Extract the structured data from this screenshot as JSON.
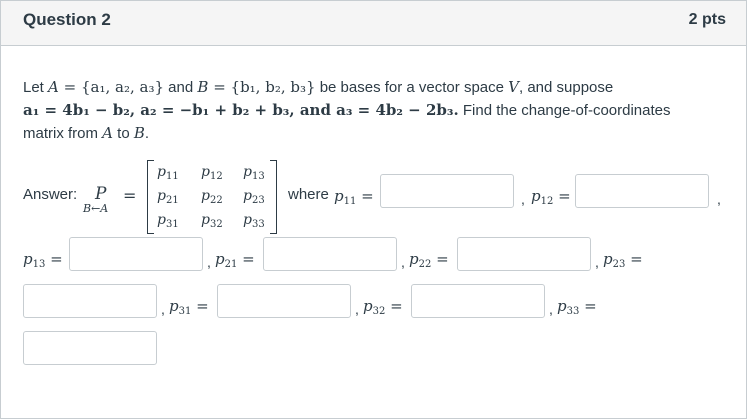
{
  "header": {
    "title": "Question 2",
    "points": "2 pts"
  },
  "question": {
    "line1_prefix": "Let ",
    "line1_A": "A",
    "line1_set_A": " = {a₁, a₂, a₃}",
    "line1_and": " and ",
    "line1_B": "B",
    "line1_set_B": " = {b₁, b₂, b₃}",
    "line1_suffix": " be bases for a vector space ",
    "line1_V": "V",
    "line1_end": ", and suppose",
    "line2_math": "a₁ = 4b₁ − b₂, a₂ = −b₁ + b₂ + b₃, and a₃ = 4b₂ − 2b₃.",
    "line2_text": " Find the change-of-coordinates",
    "line3": "matrix from ",
    "line3_A": "A",
    "line3_to": " to ",
    "line3_B": "B",
    "line3_end": "."
  },
  "answer": {
    "label": "Answer:",
    "P": "P",
    "P_sub": "B←A",
    "equals": "=",
    "where": "where",
    "matrix": [
      [
        "p11",
        "p12",
        "p13"
      ],
      [
        "p21",
        "p22",
        "p23"
      ],
      [
        "p31",
        "p32",
        "p33"
      ]
    ]
  },
  "fields": {
    "p11": {
      "label": "p",
      "sub": "11",
      "value": ""
    },
    "p12": {
      "label": "p",
      "sub": "12",
      "value": ""
    },
    "p13": {
      "label": "p",
      "sub": "13",
      "value": ""
    },
    "p21": {
      "label": "p",
      "sub": "21",
      "value": ""
    },
    "p22": {
      "label": "p",
      "sub": "22",
      "value": ""
    },
    "p23": {
      "label": "p",
      "sub": "23",
      "value": ""
    },
    "p31": {
      "label": "p",
      "sub": "31",
      "value": ""
    },
    "p32": {
      "label": "p",
      "sub": "32",
      "value": ""
    },
    "p33": {
      "label": "p",
      "sub": "33",
      "value": ""
    }
  }
}
